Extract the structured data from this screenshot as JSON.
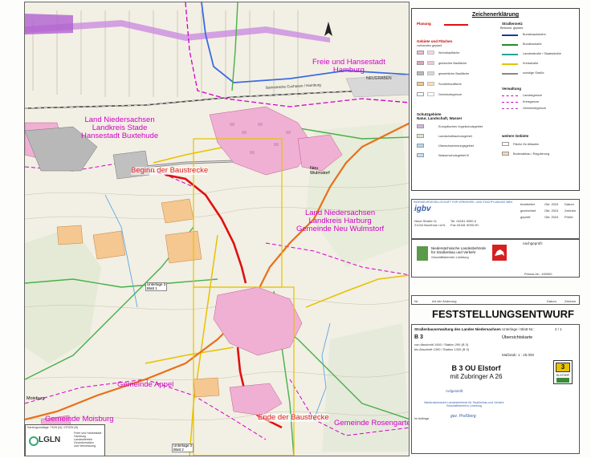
{
  "map": {
    "place_labels": [
      {
        "id": "hamburg",
        "text": "Freie und Hansestadt\nHamburg"
      },
      {
        "id": "stade",
        "text": "Land Niedersachsen\nLandkreis Stade\nHansestadt Buxtehude"
      },
      {
        "id": "harburg",
        "text": "Land Niedersachsen\nLandkreis Harburg\nGemeinde Neu Wulmstorf"
      },
      {
        "id": "appel",
        "text": "Gemeinde Appel"
      },
      {
        "id": "moisburg",
        "text": "Gemeinde Moisburg"
      },
      {
        "id": "rosengarten",
        "text": "Gemeinde Rosengarten"
      }
    ],
    "red_labels": [
      {
        "id": "beginn",
        "text": "Beginn der Baustrecke"
      },
      {
        "id": "ende",
        "text": "Ende der Baustrecke"
      }
    ],
    "small_labels": {
      "neugraben": "NEUGRABEN",
      "neu_wulmstorf": "Neu\nWulmstorf",
      "moisburg_town": "Moisburg",
      "unterlage3": "Unterlage 3\nBlatt 1",
      "unterlage2": "Unterlage 2\nBlatt 2",
      "bahn": "Bahnstrecke Cuxhaven / Hamburg",
      "lglm_note": "Kartengrundlage: TK25 (N) / DTK25 (N)"
    },
    "lgln": {
      "logo": "LGLN",
      "text": "Freie und Hansestadt\nHamburg\nLandesbetrieb\nGeoinformation\nund Vermessung"
    },
    "north_arrow_icon": "north-arrow-icon"
  },
  "legend": {
    "title": "Zeichenerklärung",
    "planung": "Planung",
    "strassennetz": "Straßennetz",
    "bestand": "Bestand",
    "geplant": "geplant",
    "gebiete": "Gebiete und Flächen",
    "gebiete_sub": "vorhanden     geplant",
    "items_left": [
      "Wohnbaufläche",
      "gemischte Baufläche",
      "gewerbliche Baufläche",
      "Sonderbaufläche",
      "Gemeindegrenze"
    ],
    "items_right": [
      "Bundesautobahn",
      "Bundesstraße",
      "Landesstraße / Staatsstraße",
      "Kreisstraße",
      "sonstige Straße"
    ],
    "verwaltung": "Verwaltung",
    "verwaltung_items": [
      "Landesgrenze",
      "Kreisgrenze",
      "Gemeindegrenze"
    ],
    "schutz": "Schutzgebiete\nNatur, Landschaft, Wasser",
    "schutz_items": [
      "Europäisches Vogelschutzgebiet",
      "Landschaftsschutzgebiet",
      "Überschwemmungsgebiet",
      "Wasserschutzgebiet III"
    ],
    "weitere": "weitere Gebiete",
    "weitere_items": [
      "Fläche für Altlasten",
      "Bodenabbau / Regulierung"
    ],
    "colors": {
      "wohn": "#f2b8d8",
      "gemischt": "#e7a0b8",
      "gewerbe": "#bbbbbb",
      "sonder": "#f4c890",
      "schutz": "#d8b0e8",
      "wasser": "#b8d8f0",
      "abbau": "#f8d8b8"
    }
  },
  "stamp": {
    "org": "INGENIEURGESELLSCHAFT FÜR VERKEHRS- UND STADTPLANUNG MBH",
    "logo": "igbv",
    "rows": [
      [
        "bearbeitet",
        "Okt. 2024",
        "Datum"
      ],
      [
        "gezeichnet",
        "Okt. 2024",
        "Zeichen"
      ],
      [
        "geprüft",
        "Okt. 2024",
        "Prüfer"
      ]
    ],
    "address": "Neue Straße 11\n21244 Buchholz i.d.N.",
    "phone": "Tel. 04181 9090-0\nFax 04181 9090-90"
  },
  "authority": {
    "name": "Niedersächsische Landesbehörde\nfür Straßenbau und Verkehr",
    "sub": "Geschäftsbereich Lüneburg",
    "nachgeprueft": "nachgeprüft:",
    "primas": "Primas-Nr.: 105900"
  },
  "revision": {
    "nr": "Nr.",
    "art": "Art der Änderung",
    "datum": "Datum",
    "zeichen": "Zeichen"
  },
  "title": {
    "main": "FESTSTELLUNGSENTWURF",
    "verwaltung": "Straßenbauverwaltung des Landes Niedersachsen",
    "road": "B 3",
    "von": "von Abschnitt 1450 / Station 290 (B 3)",
    "bis": "bis Abschnitt 1390 / Station 1320 (B 3)",
    "unterlage": "Unterlage / Blatt-Nr.:",
    "unterlage_val": "2 / 1",
    "karte": "Übersichtskarte",
    "massstab": "Maßstab: 1 : 25.000",
    "projekt": "B 3 OU Elstorf",
    "projekt_sub": "mit Zubringer A 26",
    "aufgestellt": "Aufgestellt:",
    "aufgestellt_org": "Niedersächsische Landesbehörde für Straßenbau und Verkehr\nGeschäftsbereich Lüneburg",
    "signature": "gez. Preßberg",
    "sign_label": "Im Auftrage",
    "road_badge": "3",
    "badge_sub": "ELSTORF"
  }
}
